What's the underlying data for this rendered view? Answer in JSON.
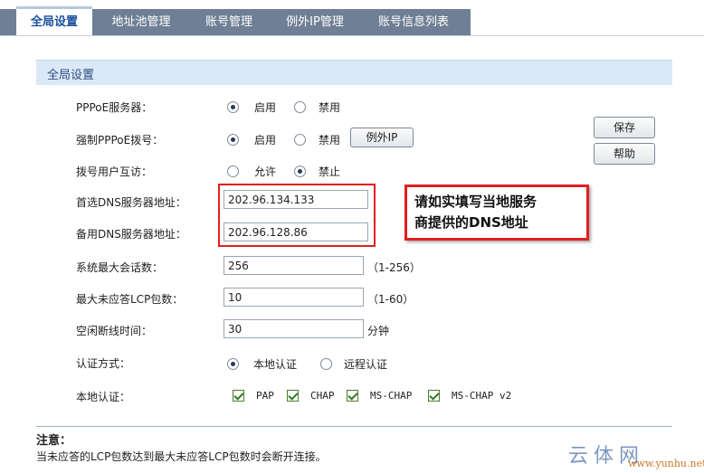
{
  "tabs": [
    {
      "label": "全局设置",
      "active": true
    },
    {
      "label": "地址池管理",
      "active": false
    },
    {
      "label": "账号管理",
      "active": false
    },
    {
      "label": "例外IP管理",
      "active": false
    },
    {
      "label": "账号信息列表",
      "active": false
    }
  ],
  "section": {
    "title": "全局设置"
  },
  "form": {
    "pppoe_server": {
      "label": "PPPoE服务器：",
      "opt_on": "启用",
      "opt_off": "禁用",
      "selected": "启用"
    },
    "force_pppoe": {
      "label": "强制PPPoE拨号：",
      "opt_on": "启用",
      "opt_off": "禁用",
      "selected": "启用",
      "exception_button": "例外IP"
    },
    "user_access": {
      "label": "拨号用户互访：",
      "opt_allow": "允许",
      "opt_deny": "禁止",
      "selected": "禁止"
    },
    "dns_primary": {
      "label": "首选DNS服务器地址：",
      "value": "202.96.134.133"
    },
    "dns_secondary": {
      "label": "备用DNS服务器地址：",
      "value": "202.96.128.86"
    },
    "max_sessions": {
      "label": "系统最大会话数：",
      "value": "256",
      "hint": "（1-256）"
    },
    "max_lcp": {
      "label": "最大未应答LCP包数：",
      "value": "10",
      "hint": "（1-60）"
    },
    "idle_time": {
      "label": "空闲断线时间：",
      "value": "30",
      "unit": "分钟"
    },
    "auth_method": {
      "label": "认证方式：",
      "opt_local": "本地认证",
      "opt_remote": "远程认证",
      "selected": "本地认证"
    },
    "local_auth": {
      "label": "本地认证：",
      "options": [
        "PAP",
        "CHAP",
        "MS-CHAP",
        "MS-CHAP v2"
      ]
    }
  },
  "buttons": {
    "save": "保存",
    "help": "帮助"
  },
  "callout": {
    "text_line1": "请如实填写当地服务",
    "text_line2": "商提供的DNS地址"
  },
  "note": {
    "title": "注意：",
    "text": "当未应答的LCP包数达到最大未应答LCP包数时会断开连接。"
  },
  "watermark": {
    "logo": "云体网",
    "url": "www.yunhu.net"
  },
  "colors": {
    "tab_bar": "#6f7f95",
    "section_bg": "#dbe8f7",
    "highlight_red": "#e02020"
  }
}
